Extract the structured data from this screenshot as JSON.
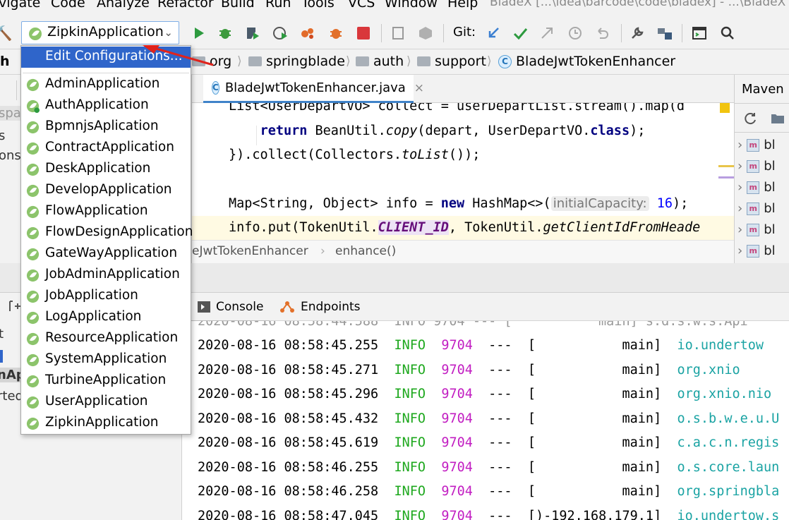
{
  "menubar": {
    "items": [
      "vigate",
      "Code",
      "Analyze",
      "Refactor",
      "Build",
      "Run",
      "Tools",
      "VCS",
      "Window",
      "Help"
    ],
    "window_title": "BladeX [...\\idea\\barcode\\code\\bladex] - ...\\BladeX"
  },
  "toolbar": {
    "run_config": "ZipkinApplication",
    "git_label": "Git:",
    "icons": [
      "hammer-icon",
      "run-icon",
      "debug-icon",
      "coverage-icon",
      "profile-icon",
      "run-concurrent-icon",
      "bug-icon",
      "stop-icon",
      "frame-icon",
      "cube-icon",
      "git-update-icon",
      "git-commit-icon",
      "git-merge-icon",
      "history-icon",
      "revert-icon",
      "settings-icon",
      "project-structure-icon",
      "terminal-icon",
      "search-icon"
    ]
  },
  "breadcrumb": {
    "partial": "h",
    "items": [
      "org",
      "springblade",
      "auth",
      "support",
      "BladeJwtTokenEnhancer"
    ]
  },
  "left_panel": {
    "fragments": [
      "spac",
      "s",
      "onso"
    ]
  },
  "editor": {
    "tab_label": "BladeJwtTokenEnhancer.java",
    "tab_close": "×",
    "lines": {
      "l1": "List<UserDepartVO> collect = userDepartList.stream().map(d",
      "l2_indent": "    ",
      "l2_kw": "return",
      "l2_a": " BeanUtil.",
      "l2_b": "copy",
      "l2_c": "(depart, UserDepartVO.",
      "l2_d": "class",
      "l2_e": ");",
      "l3_a": "}).collect(Collectors.",
      "l3_b": "toList",
      "l3_c": "());",
      "l4_a": "Map<String, Object> info = ",
      "l4_kw": "new",
      "l4_b": " HashMap<>(",
      "l4_hint": "initialCapacity:",
      "l4_num": "16",
      "l4_c": ");",
      "l5_a": "info.put(TokenUtil.",
      "l5_field": "CLIENT_ID",
      "l5_b": ", TokenUtil.",
      "l5_c": "getClientIdFromHeade"
    },
    "footer_crumb": [
      "eJwtTokenEnhancer",
      "enhance()"
    ]
  },
  "maven": {
    "title": "Maven",
    "rows": [
      "bl",
      "bl",
      "bl",
      "bl",
      "bl",
      "bl"
    ]
  },
  "bottom_left": {
    "fragments": [
      "t",
      "nAp",
      "rted"
    ]
  },
  "console": {
    "tabs": [
      "Console",
      "Endpoints"
    ],
    "top_partial": "2020-08-16 08:58:44.588  INFO 9704 --- [           main] s.d.s.w.s.Api",
    "lines": [
      {
        "time": "2020-08-16 08:58:45.255",
        "level": "INFO",
        "pid": "9704",
        "sep": "---",
        "thread": "[           main]",
        "logger": "io.undertow"
      },
      {
        "time": "2020-08-16 08:58:45.271",
        "level": "INFO",
        "pid": "9704",
        "sep": "---",
        "thread": "[           main]",
        "logger": "org.xnio"
      },
      {
        "time": "2020-08-16 08:58:45.296",
        "level": "INFO",
        "pid": "9704",
        "sep": "---",
        "thread": "[           main]",
        "logger": "org.xnio.nio"
      },
      {
        "time": "2020-08-16 08:58:45.432",
        "level": "INFO",
        "pid": "9704",
        "sep": "---",
        "thread": "[           main]",
        "logger": "o.s.b.w.e.u.U"
      },
      {
        "time": "2020-08-16 08:58:45.619",
        "level": "INFO",
        "pid": "9704",
        "sep": "---",
        "thread": "[           main]",
        "logger": "c.a.c.n.regis"
      },
      {
        "time": "2020-08-16 08:58:46.255",
        "level": "INFO",
        "pid": "9704",
        "sep": "---",
        "thread": "[           main]",
        "logger": "o.s.core.laun"
      },
      {
        "time": "2020-08-16 08:58:46.258",
        "level": "INFO",
        "pid": "9704",
        "sep": "---",
        "thread": "[           main]",
        "logger": "org.springbla"
      },
      {
        "time": "2020-08-16 08:58:47.045",
        "level": "INFO",
        "pid": "9704",
        "sep": "---",
        "thread": "[)-192.168.179.1]",
        "logger": "io.undertow.s"
      }
    ]
  },
  "dropdown": {
    "edit_config": "Edit Configurations...",
    "apps": [
      "AdminApplication",
      "AuthApplication",
      "BpmnjsAplication",
      "ContractApplication",
      "DeskApplication",
      "DevelopApplication",
      "FlowApplication",
      "FlowDesignApplication",
      "GateWayApplication",
      "JobAdminApplication",
      "JobApplication",
      "LogApplication",
      "ResourceApplication",
      "SystemApplication",
      "TurbineApplication",
      "UserApplication",
      "ZipkinApplication"
    ]
  },
  "colors": {
    "selection": "#2f65ca",
    "arrow": "#e0231c",
    "info": "#1ea81e",
    "pid": "#c21ec2",
    "logger": "#1aa3a3"
  }
}
